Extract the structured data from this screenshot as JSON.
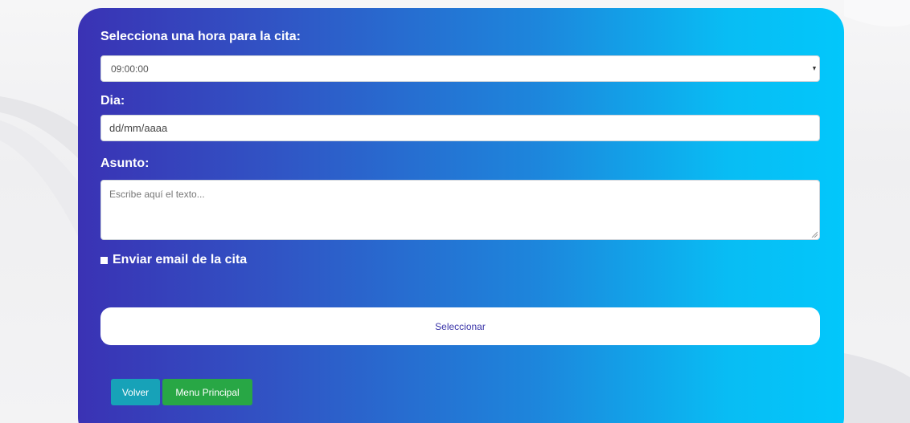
{
  "form": {
    "time_label": "Selecciona una hora para la cita:",
    "time_value": "09:00:00",
    "day_label": "Dia:",
    "day_placeholder": "dd/mm/aaaa",
    "subject_label": "Asunto:",
    "subject_placeholder": "Escribe aquí el texto...",
    "email_checkbox_label": "Enviar email de la cita",
    "select_button_label": "Seleccionar"
  },
  "footer_buttons": {
    "back_label": "Volver",
    "main_menu_label": "Menu Principal"
  },
  "colors": {
    "card_gradient_start": "#3a32b4",
    "card_gradient_end": "#02c7fb",
    "back_button": "#17a2b8",
    "main_menu_button": "#28a745",
    "select_button_text": "#3a34a8"
  }
}
